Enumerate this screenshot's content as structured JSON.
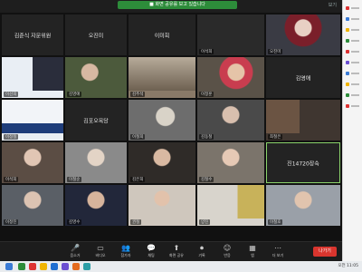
{
  "banner": "■ 화면 공유를 보고 있습니다",
  "top_right": "보기",
  "tiles": [
    {
      "name": "김준식 자문위원"
    },
    {
      "name": "오진미"
    },
    {
      "name": "이미희"
    },
    {
      "name": "이석희"
    },
    {
      "name": "오진미"
    },
    {
      "name": "이선희"
    },
    {
      "name": "김영애"
    },
    {
      "name": "김주석"
    },
    {
      "name": "이정훈"
    },
    {
      "name": "이정철"
    },
    {
      "name": "오철수"
    },
    {
      "name": "김동철"
    },
    {
      "name": "김포오목당"
    },
    {
      "name": "이철희"
    },
    {
      "name": "김동철"
    },
    {
      "name": "최철은"
    },
    {
      "name": "이석희"
    },
    {
      "name": "이철순"
    },
    {
      "name": "김은희"
    },
    {
      "name": "김철수"
    },
    {
      "name": "진14720장숙"
    },
    {
      "name": "이정진"
    },
    {
      "name": "김영수"
    },
    {
      "name": "권철"
    },
    {
      "name": "양진"
    },
    {
      "name": "이철호"
    },
    {
      "name": "김수희"
    }
  ],
  "center_names": {
    "t1": "김준식 자문위원",
    "t2": "오진미",
    "t3": "이미희",
    "t7": "김영애",
    "t13": "김포오목당",
    "t21": "진14720장숙"
  },
  "toolbar": {
    "mute": "음소거",
    "video": "비디오",
    "participants": "참가자",
    "chat": "채팅",
    "share": "화면 공유",
    "record": "기록",
    "reactions": "반응",
    "apps": "앱",
    "more": "더 보기",
    "leave": "나가기",
    "participants_count": "104"
  },
  "taskbar": {
    "clock": "오전 11:05"
  },
  "colors": {
    "active_border": "#8bd36b",
    "leave": "#d9352e",
    "banner": "#2d8c3a"
  }
}
